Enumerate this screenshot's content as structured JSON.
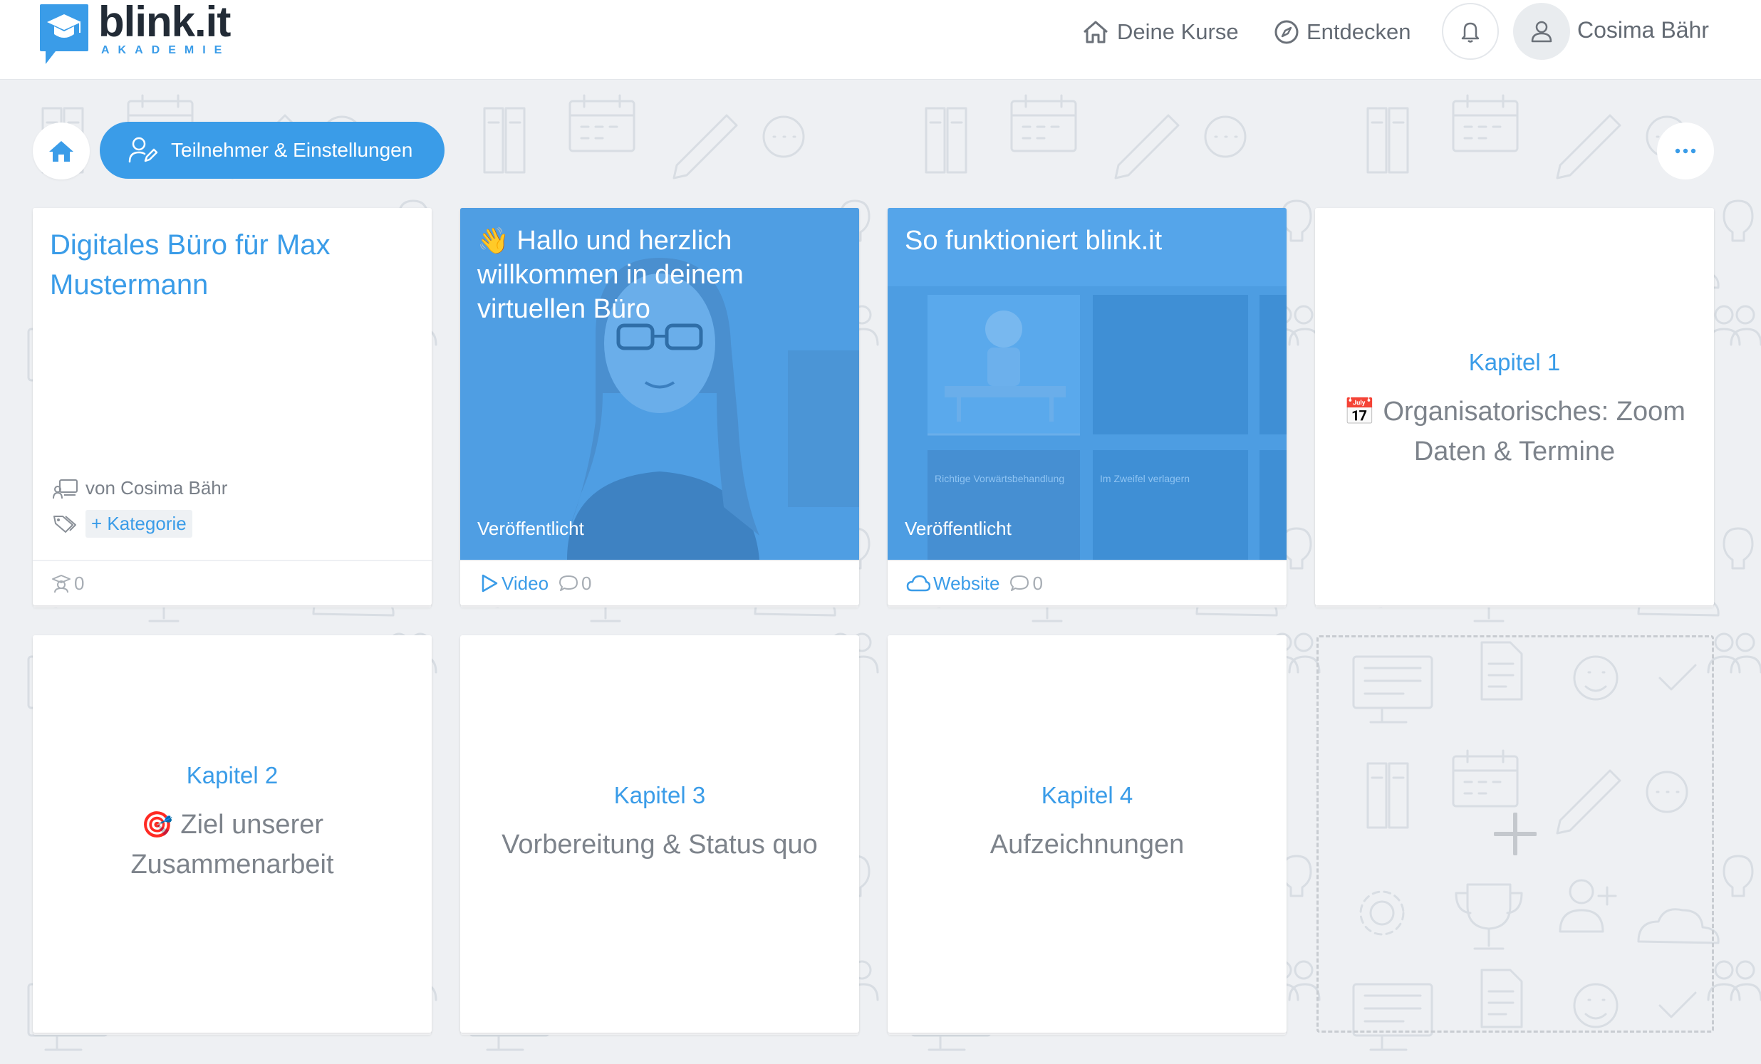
{
  "brand": {
    "name": "blink.it",
    "tagline": "AKADEMIE",
    "accent": "#3a9ce8"
  },
  "header": {
    "nav": [
      {
        "label": "Deine Kurse",
        "icon": "home-outline-icon"
      },
      {
        "label": "Entdecken",
        "icon": "compass-icon"
      }
    ],
    "notifications_icon": "bell-icon",
    "user": {
      "name": "Cosima Bähr",
      "icon": "user-icon"
    }
  },
  "toolbar": {
    "home_icon": "home-icon",
    "settings_label": "Teilnehmer & Einstellungen",
    "more_icon": "more-horizontal-icon"
  },
  "course": {
    "title": "Digitales Büro für Max Mustermann",
    "author": "von Cosima Bähr",
    "category_button": "+ Kategorie",
    "participants_count": "0"
  },
  "lessons": [
    {
      "emoji": "👋",
      "title": "Hallo und herzlich willkommen in deinem virtuellen Büro",
      "status": "Veröffentlicht",
      "type_label": "Video",
      "type_icon": "play-icon",
      "comments": "0"
    },
    {
      "title": "So funktioniert blink.it",
      "status": "Veröffentlicht",
      "type_label": "Website",
      "type_icon": "cloud-icon",
      "comments": "0",
      "preview_texts": [
        "Richtige Vorwärtsbehandlung",
        "Im Zweifel verlagern"
      ]
    }
  ],
  "chapters": [
    {
      "label": "Kapitel 1",
      "emoji": "📅",
      "title": "Organisatorisches: Zoom Daten & Termine"
    },
    {
      "label": "Kapitel 2",
      "emoji": "🎯",
      "title": "Ziel unserer Zusammenarbeit"
    },
    {
      "label": "Kapitel 3",
      "title": "Vorbereitung & Status quo"
    },
    {
      "label": "Kapitel 4",
      "title": "Aufzeichnungen"
    }
  ],
  "add_chapter_icon": "plus-icon"
}
